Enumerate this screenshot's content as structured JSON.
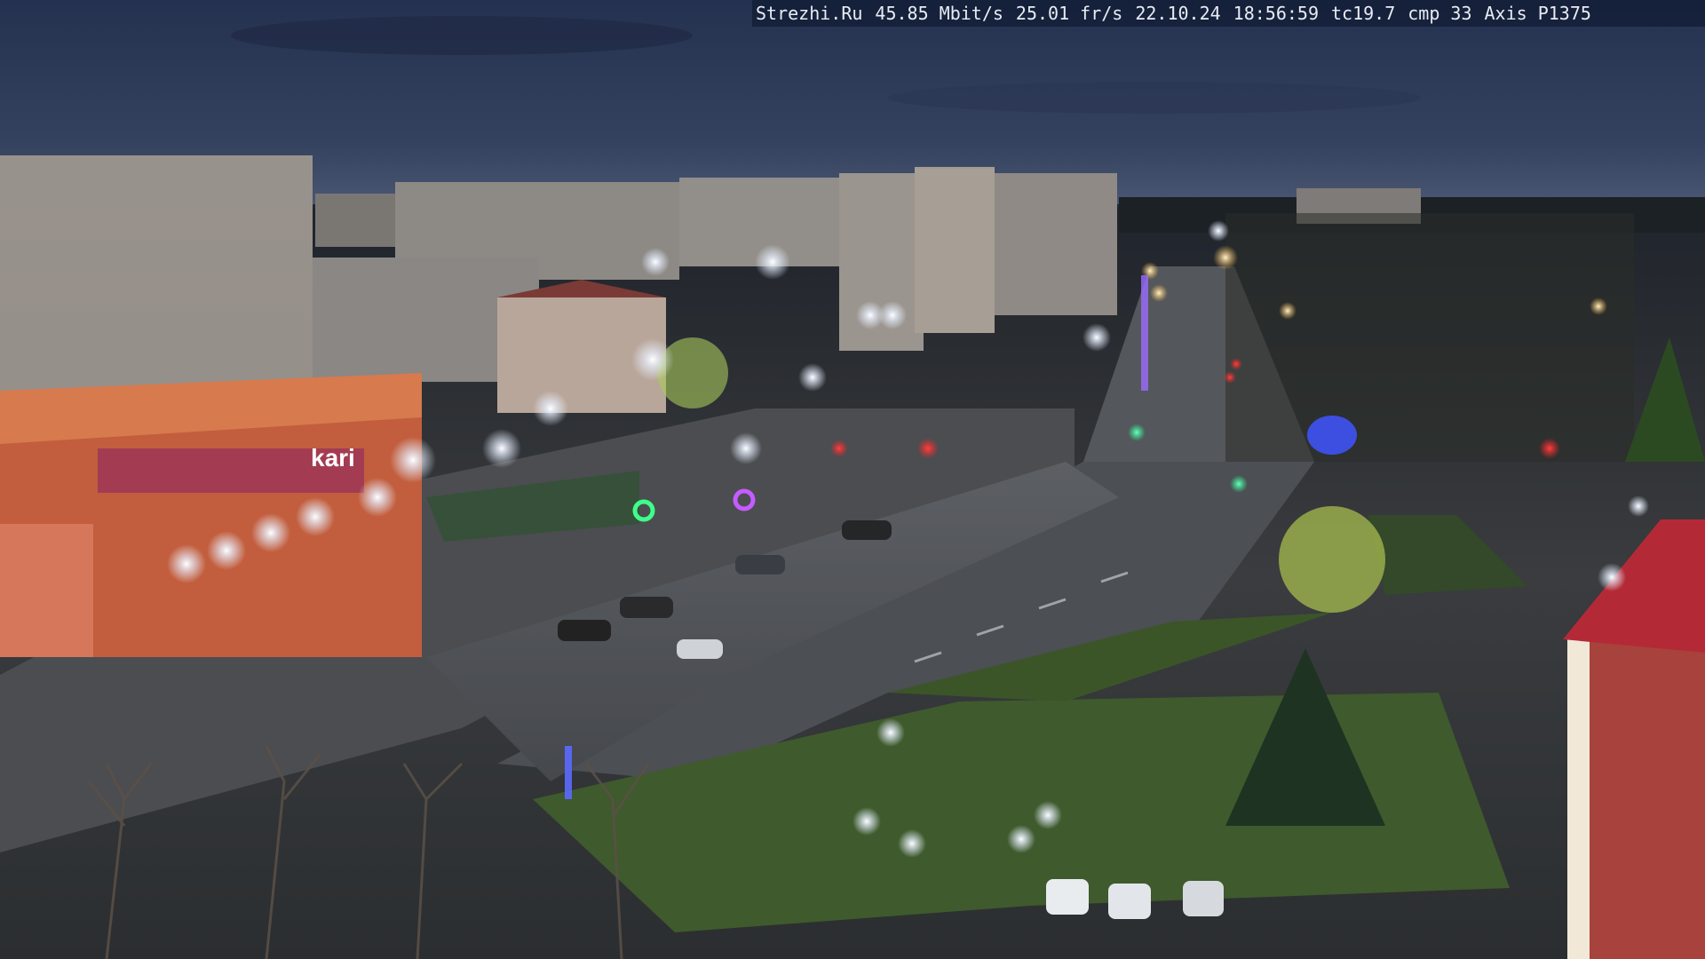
{
  "overlay": {
    "site": "Strezhi.Ru",
    "bitrate": "45.85 Mbit/s",
    "framerate": "25.01 fr/s",
    "date": "22.10.24",
    "time": "18:56:59",
    "tc": "tc19.7",
    "cmp": "cmp 33",
    "camera": "Axis P1375"
  },
  "signage": {
    "store_logo": "kari"
  },
  "colors": {
    "sky_top": "#27334f",
    "road": "#4a4d52",
    "grass": "#3d5a2c",
    "streetlight": "#f4f8ff",
    "signal_red": "#ff2a2a",
    "signal_green": "#2aff9a"
  }
}
